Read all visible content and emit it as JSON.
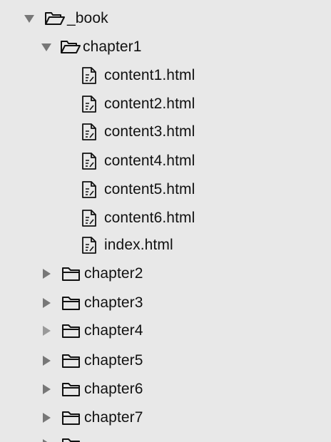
{
  "tree": {
    "root": {
      "label": "_book",
      "expanded": true,
      "icon": "folder-open-icon"
    },
    "chapter1": {
      "label": "chapter1",
      "expanded": true,
      "icon": "folder-open-icon",
      "files": [
        {
          "label": "content1.html",
          "icon": "html-file-icon"
        },
        {
          "label": "content2.html",
          "icon": "html-file-icon"
        },
        {
          "label": "content3.html",
          "icon": "html-file-icon"
        },
        {
          "label": "content4.html",
          "icon": "html-file-icon"
        },
        {
          "label": "content5.html",
          "icon": "html-file-icon"
        },
        {
          "label": "content6.html",
          "icon": "html-file-icon"
        },
        {
          "label": "index.html",
          "icon": "html-file-icon"
        }
      ]
    },
    "collapsed_folders": [
      {
        "label": "chapter2",
        "icon": "folder-icon",
        "expanded": false
      },
      {
        "label": "chapter3",
        "icon": "folder-icon",
        "expanded": false
      },
      {
        "label": "chapter4",
        "icon": "folder-icon",
        "expanded": false
      },
      {
        "label": "chapter5",
        "icon": "folder-icon",
        "expanded": false
      },
      {
        "label": "chapter6",
        "icon": "folder-icon",
        "expanded": false
      },
      {
        "label": "chapter7",
        "icon": "folder-icon",
        "expanded": false
      }
    ]
  }
}
